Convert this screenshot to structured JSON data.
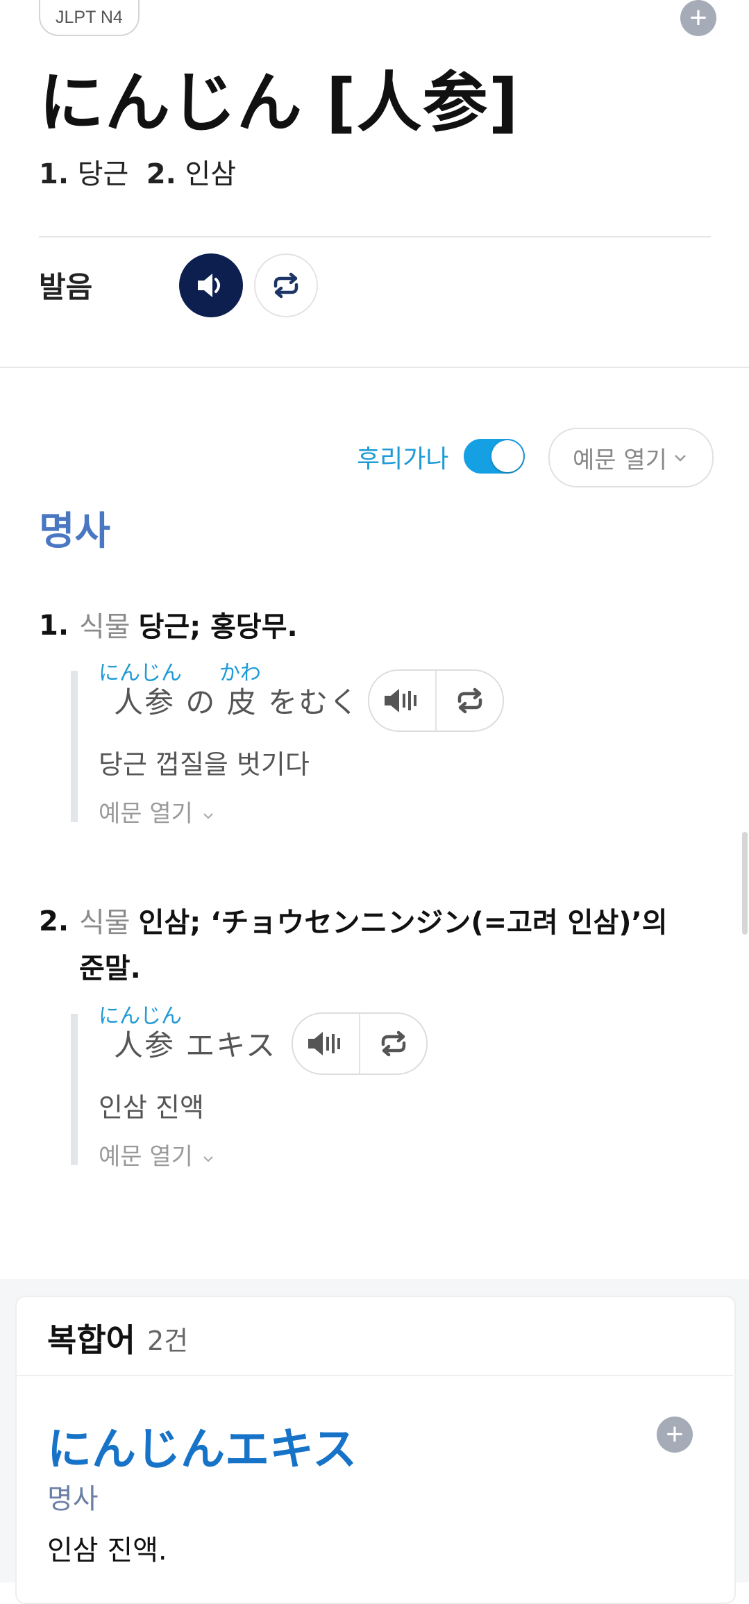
{
  "header": {
    "level_badge": "JLPT N4",
    "headword": "にんじん [人参]",
    "summary": [
      {
        "num": "1.",
        "text": "당근"
      },
      {
        "num": "2.",
        "text": "인삼"
      }
    ]
  },
  "pronunciation": {
    "label": "발음"
  },
  "controls": {
    "furigana_label": "후리가나",
    "furigana_on": true,
    "open_examples_label": "예문 열기"
  },
  "part_of_speech": "명사",
  "senses": [
    {
      "num": "1.",
      "field": "식물",
      "definition": "당근; 홍당무.",
      "example": {
        "furigana": [
          "にんじん",
          "かわ"
        ],
        "japanese": [
          "人参",
          "の",
          "皮",
          "をむく"
        ],
        "korean": "당근 껍질을 벗기다",
        "open_label": "예문 열기"
      }
    },
    {
      "num": "2.",
      "field": "식물",
      "definition": "인삼; ‘チョウセンニンジン(=고려 인삼)’의",
      "definition_line2": "준말.",
      "example": {
        "furigana": [
          "にんじん"
        ],
        "japanese": [
          "人参",
          "エキス"
        ],
        "korean": "인삼 진액",
        "open_label": "예문 열기"
      }
    }
  ],
  "compounds": {
    "title": "복합어",
    "count": "2건",
    "items": [
      {
        "word": "にんじんエキス",
        "pos": "명사",
        "definition": "인삼 진액."
      }
    ]
  },
  "icons": {
    "add": "plus-icon",
    "speaker": "speaker-icon",
    "repeat": "repeat-icon",
    "chevron": "chevron-down-icon"
  },
  "colors": {
    "accent_blue": "#1e9ad6",
    "pos_blue": "#4a77c2",
    "compound_blue": "#1673c8",
    "dark_navy": "#0c1f4f",
    "toggle_blue": "#15a0e4"
  }
}
